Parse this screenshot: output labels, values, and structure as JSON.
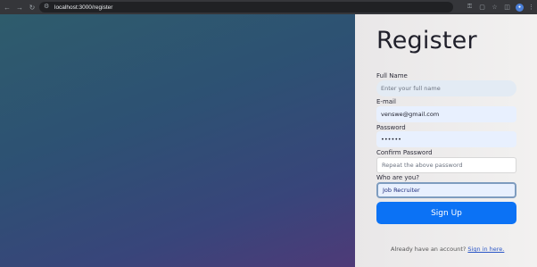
{
  "browser": {
    "url": "localhost:3000/register",
    "icons": {
      "back": "back-arrow-icon",
      "forward": "forward-arrow-icon",
      "reload": "reload-icon",
      "site_info": "site-info-icon",
      "key": "key-icon",
      "install": "install-icon",
      "bookmark": "star-icon",
      "extensions": "puzzle-icon",
      "profile": "profile-avatar",
      "menu": "kebab-menu-icon"
    }
  },
  "form": {
    "title": "Register",
    "full_name": {
      "label": "Full Name",
      "placeholder": "Enter your full name",
      "value": ""
    },
    "email": {
      "label": "E-mail",
      "value": "venswe@gmail.com"
    },
    "password": {
      "label": "Password",
      "value": "••••••"
    },
    "confirm_password": {
      "label": "Confirm Password",
      "placeholder": "Repeat the above password",
      "value": ""
    },
    "role": {
      "label": "Who are you?",
      "value": "Job Recruiter"
    },
    "submit_label": "Sign Up",
    "footer_text": "Already have an account?",
    "footer_link": "Sign in here."
  },
  "colors": {
    "accent": "#0b72f5",
    "link": "#2a56c6"
  }
}
